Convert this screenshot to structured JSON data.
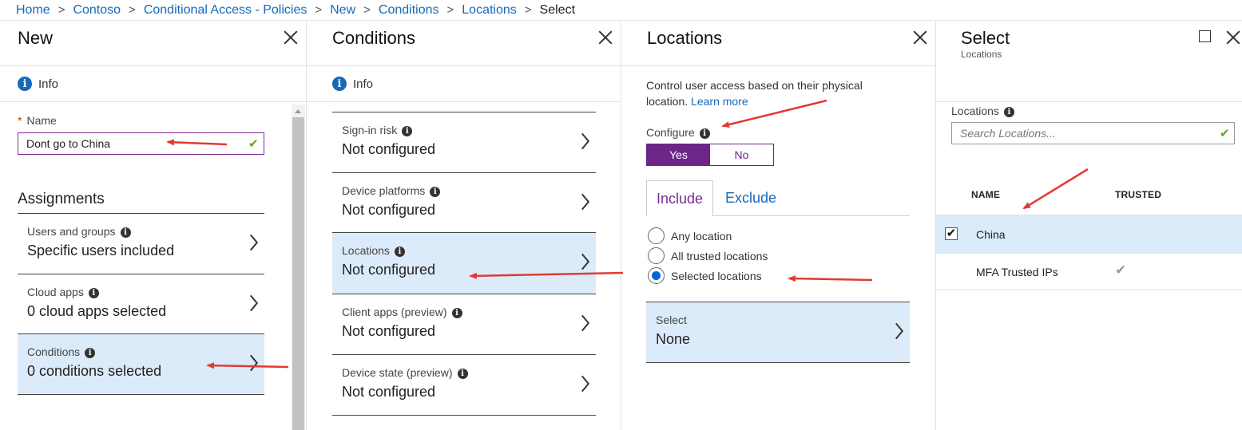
{
  "breadcrumb": {
    "items": [
      "Home",
      "Contoso",
      "Conditional Access - Policies",
      "New",
      "Conditions",
      "Locations"
    ],
    "current": "Select"
  },
  "new_blade": {
    "title": "New",
    "info": "Info",
    "name_label": "Name",
    "name_value": "Dont go to China",
    "assignments_heading": "Assignments",
    "items": [
      {
        "label": "Users and groups",
        "value": "Specific users included"
      },
      {
        "label": "Cloud apps",
        "value": "0 cloud apps selected"
      },
      {
        "label": "Conditions",
        "value": "0 conditions selected"
      }
    ]
  },
  "conditions_blade": {
    "title": "Conditions",
    "info": "Info",
    "items": [
      {
        "label": "Sign-in risk",
        "value": "Not configured"
      },
      {
        "label": "Device platforms",
        "value": "Not configured"
      },
      {
        "label": "Locations",
        "value": "Not configured"
      },
      {
        "label": "Client apps (preview)",
        "value": "Not configured"
      },
      {
        "label": "Device state (preview)",
        "value": "Not configured"
      }
    ]
  },
  "locations_blade": {
    "title": "Locations",
    "description": "Control user access based on their physical location.",
    "learn_more": "Learn more",
    "configure_label": "Configure",
    "toggle_yes": "Yes",
    "toggle_no": "No",
    "tab_include": "Include",
    "tab_exclude": "Exclude",
    "radios": [
      "Any location",
      "All trusted locations",
      "Selected locations"
    ],
    "select_label": "Select",
    "select_value": "None"
  },
  "select_blade": {
    "title": "Select",
    "subtitle": "Locations",
    "locations_label": "Locations",
    "search_placeholder": "Search Locations...",
    "col_name": "NAME",
    "col_trusted": "TRUSTED",
    "rows": [
      {
        "name": "China",
        "checked": true,
        "trusted": false
      },
      {
        "name": "MFA Trusted IPs",
        "checked": false,
        "trusted": true
      }
    ]
  },
  "colors": {
    "accent_purple": "#6b2688",
    "link_blue": "#1669b8",
    "selected_row": "#dcebfa",
    "annotation_red": "#e23a32"
  },
  "icons": [
    "info-icon",
    "close-icon",
    "maximize-icon",
    "chevron-right-icon",
    "checkmark-icon",
    "radio-icon"
  ]
}
